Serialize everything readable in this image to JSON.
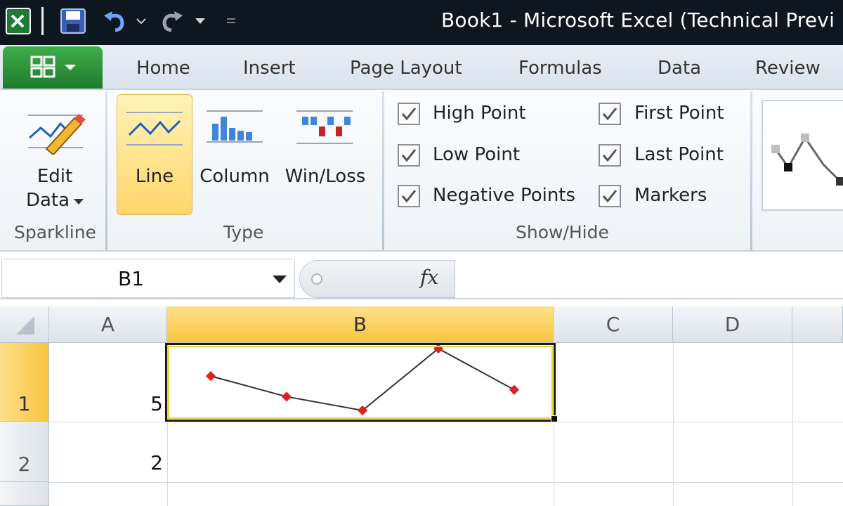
{
  "window": {
    "title": "Book1  -  Microsoft Excel (Technical Previ"
  },
  "quick_access": {
    "icons": [
      "excel-logo-icon",
      "save-icon",
      "undo-icon",
      "redo-icon",
      "customize-icon"
    ]
  },
  "tabs": [
    "Home",
    "Insert",
    "Page Layout",
    "Formulas",
    "Data",
    "Review"
  ],
  "ribbon": {
    "sparkline_group": {
      "label": "Sparkline",
      "edit_data_line1": "Edit",
      "edit_data_line2": "Data"
    },
    "type_group": {
      "label": "Type",
      "line": "Line",
      "column": "Column",
      "winloss": "Win/Loss",
      "selected": "Line"
    },
    "showhide_group": {
      "label": "Show/Hide",
      "checkboxes": [
        {
          "label": "High Point",
          "checked": true
        },
        {
          "label": "Low Point",
          "checked": true
        },
        {
          "label": "Negative Points",
          "checked": true
        },
        {
          "label": "First Point",
          "checked": true
        },
        {
          "label": "Last Point",
          "checked": true
        },
        {
          "label": "Markers",
          "checked": true
        }
      ]
    }
  },
  "formula_bar": {
    "name_box": "B1",
    "fx_label": "fx",
    "formula": ""
  },
  "sheet": {
    "columns": [
      "A",
      "B",
      "C",
      "D"
    ],
    "rows": [
      "1",
      "2"
    ],
    "selected_cell": "B1",
    "cells": {
      "A1": "5",
      "A2": "2"
    }
  },
  "sparkline": {
    "values": [
      5,
      2,
      0,
      9,
      3
    ],
    "marker_color": "#e02020",
    "line_color": "#333333"
  },
  "colors": {
    "title_bar": "#0e1620",
    "file_tab": "#1f7a2c",
    "selection_highlight": "#f7c43d"
  }
}
